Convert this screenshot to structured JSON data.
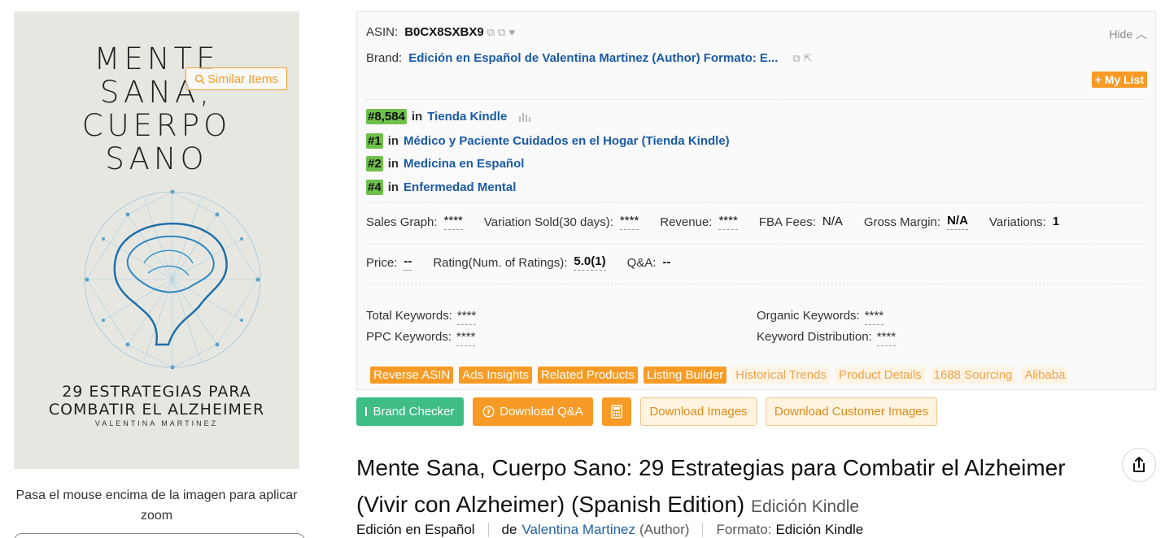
{
  "cover": {
    "title_lines": [
      "MENTE",
      "SANA,",
      "CUERPO",
      "SANO"
    ],
    "subtitle_lines": [
      "29 ESTRATEGIAS PARA",
      "COMBATIR EL ALZHEIMER"
    ],
    "author": "VALENTINA MARTINEZ",
    "similar_label": "Similar Items",
    "hover_hint": "Pasa el mouse encima de la imagen para aplicar zoom"
  },
  "panel": {
    "asin_label": "ASIN:",
    "asin_value": "B0CX8SXBX9",
    "hide_label": "Hide",
    "brand_label": "Brand:",
    "brand_value": "Edición en Español de Valentina Martinez (Author) Formato: E...",
    "mylist_label": "+ My List",
    "ranks": [
      {
        "rank": "#8,584",
        "in": "in",
        "category": "Tienda Kindle"
      },
      {
        "rank": "#1",
        "in": "in",
        "category": "Médico y Paciente Cuidados en el Hogar (Tienda Kindle)"
      },
      {
        "rank": "#2",
        "in": "in",
        "category": "Medicina en Español"
      },
      {
        "rank": "#4",
        "in": "in",
        "category": "Enfermedad Mental"
      }
    ],
    "metrics_row1": [
      {
        "label": "Sales Graph:",
        "value": "****"
      },
      {
        "label": "Variation Sold(30 days):",
        "value": "****"
      },
      {
        "label": "Revenue:",
        "value": "****"
      },
      {
        "label": "FBA Fees:",
        "value": "N/A"
      },
      {
        "label": "Gross Margin:",
        "value": "N/A"
      },
      {
        "label": "Variations:",
        "value": "1"
      }
    ],
    "metrics_row2": [
      {
        "label": "Price:",
        "value": "--"
      },
      {
        "label": "Rating(Num. of Ratings):",
        "value": "5.0(1)"
      },
      {
        "label": "Q&A:",
        "value": "--"
      }
    ],
    "keywords": {
      "total_label": "Total Keywords:",
      "total_value": "****",
      "ppc_label": "PPC Keywords:",
      "ppc_value": "****",
      "organic_label": "Organic Keywords:",
      "organic_value": "****",
      "dist_label": "Keyword Distribution:",
      "dist_value": "****"
    },
    "tools": [
      {
        "label": "Reverse ASIN",
        "style": "solid"
      },
      {
        "label": "Ads Insights",
        "style": "solid"
      },
      {
        "label": "Related Products",
        "style": "solid"
      },
      {
        "label": "Listing Builder",
        "style": "solid"
      },
      {
        "label": "Historical Trends",
        "style": "light"
      },
      {
        "label": "Product Details",
        "style": "light"
      },
      {
        "label": "1688 Sourcing",
        "style": "light"
      },
      {
        "label": "Alibaba",
        "style": "light"
      }
    ]
  },
  "actions": {
    "brand_checker": "Brand Checker",
    "download_qa": "Download Q&A",
    "download_images": "Download Images",
    "download_customer_images": "Download Customer Images"
  },
  "product": {
    "title": "Mente Sana, Cuerpo Sano: 29 Estrategias para Combatir el Alzheimer (Vivir con Alzheimer) (Spanish Edition)",
    "edition": "Edición Kindle",
    "edition_label": "Edición en Español",
    "by": "de",
    "author": "Valentina Martinez",
    "author_role": "(Author)",
    "format_label": "Formato:",
    "format_value": "Edición Kindle"
  },
  "colors": {
    "accent": "#f79b26",
    "rank_green": "#6fc04a",
    "link": "#1a5aa6",
    "brand_checker": "#3ebd84"
  }
}
